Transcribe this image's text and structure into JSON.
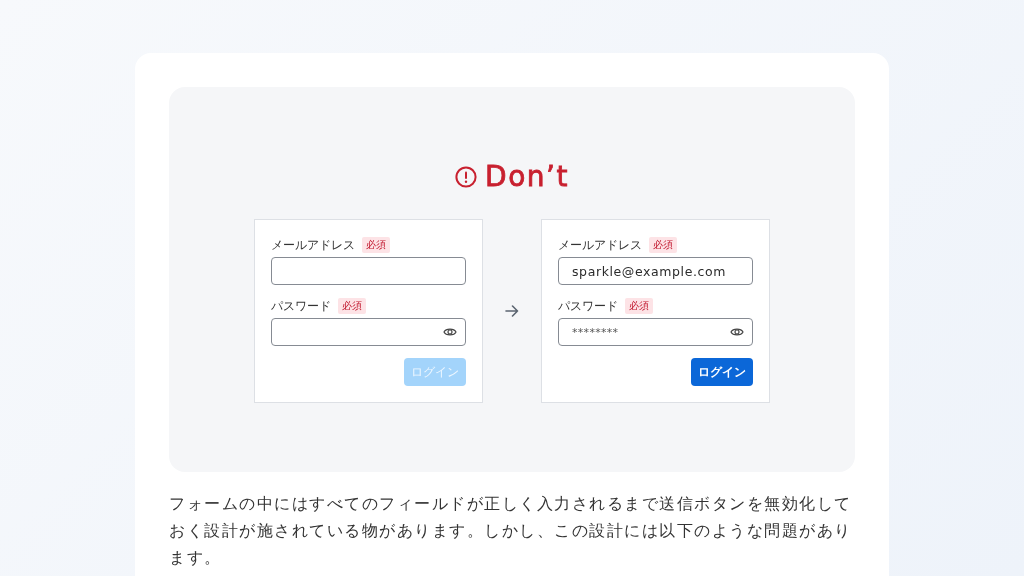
{
  "heading": {
    "text": "Don’t"
  },
  "forms": [
    {
      "fields": [
        {
          "kind": "email",
          "label": "メールアドレス",
          "badge": "必須"
        },
        {
          "kind": "password",
          "label": "パスワード",
          "badge": "必須"
        }
      ],
      "button": {
        "label": "ログイン",
        "disabled": true
      }
    },
    {
      "fields": [
        {
          "kind": "email",
          "label": "メールアドレス",
          "badge": "必須",
          "value": "sparkle@example.com"
        },
        {
          "kind": "password",
          "label": "パスワード",
          "badge": "必須",
          "value": "********"
        }
      ],
      "button": {
        "label": "ログイン",
        "disabled": false
      }
    }
  ],
  "description": "フォームの中にはすべてのフィールドが正しく入力されるまで送信ボタンを無効化しておく設計が施されている物があります。しかし、この設計には以下のような問題があります。"
}
